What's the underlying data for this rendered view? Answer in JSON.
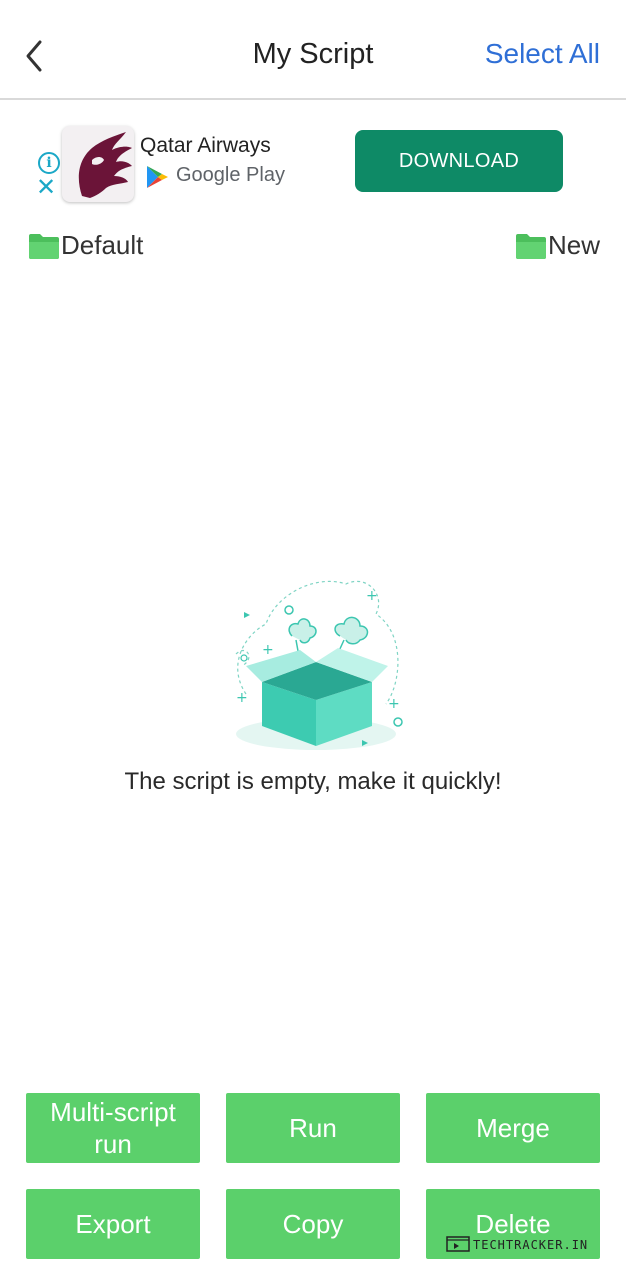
{
  "header": {
    "title": "My Script",
    "select_all": "Select All",
    "back_icon": "chevron-left-icon"
  },
  "ad": {
    "app_name": "Qatar Airways",
    "store": "Google Play",
    "cta": "DOWNLOAD",
    "colors": {
      "cta_bg": "#0e8a66",
      "logo": "#6b1438",
      "info": "#1ba8c7"
    }
  },
  "folders": {
    "default_label": "Default",
    "new_label": "New",
    "icon_color": "#5bd06b"
  },
  "empty_state": {
    "message": "The script is empty, make it quickly!",
    "illustration": "open-box-illustration"
  },
  "actions": {
    "multi_script_line1": "Multi-script",
    "multi_script_line2": "run",
    "run": "Run",
    "merge": "Merge",
    "export": "Export",
    "copy": "Copy",
    "delete": "Delete",
    "button_color": "#5bd06b"
  },
  "watermark": {
    "text": "TECHTRACKER.IN"
  }
}
